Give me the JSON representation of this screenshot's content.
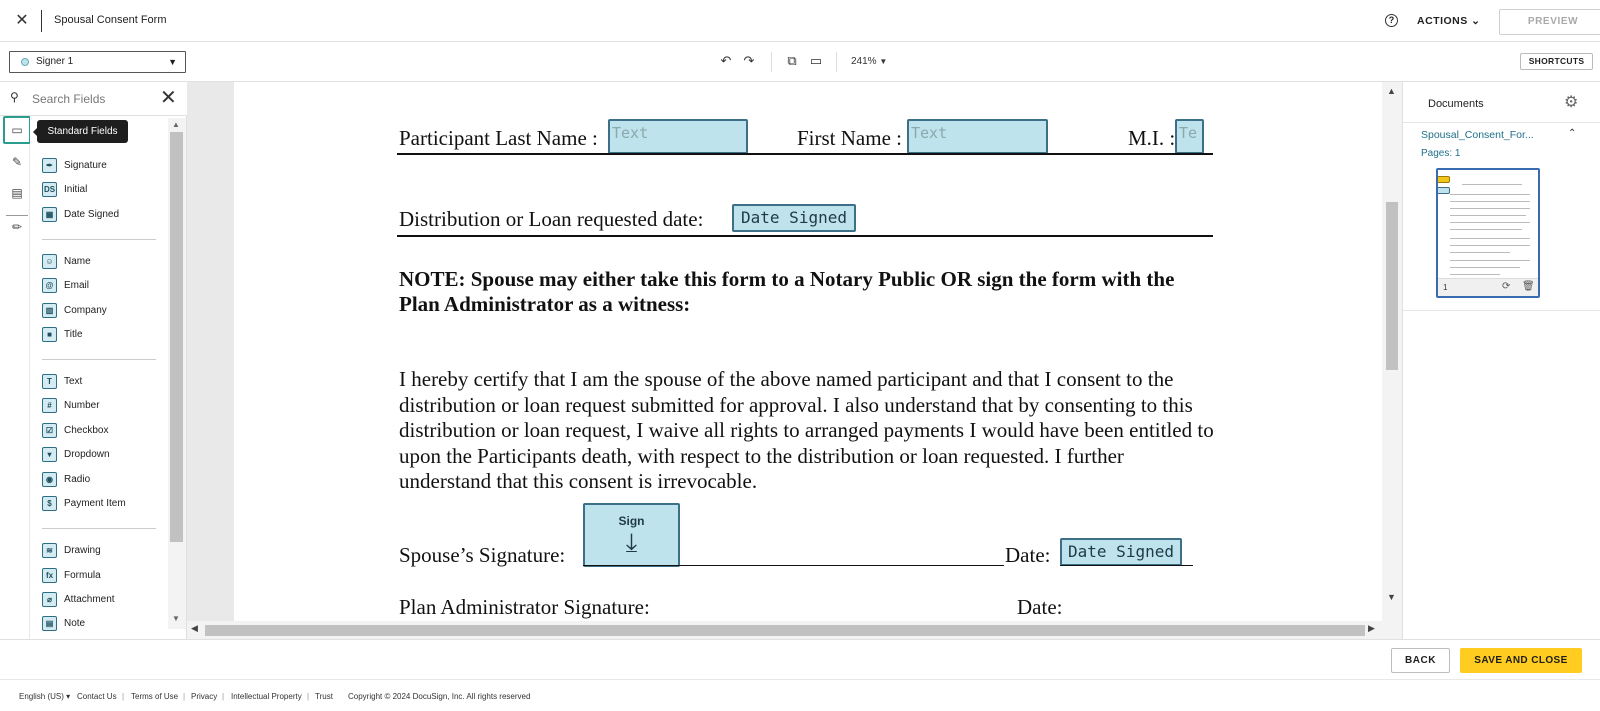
{
  "window": {
    "title": "Spousal Consent Form"
  },
  "header": {
    "actions_label": "ACTIONS",
    "preview_label": "PREVIEW"
  },
  "toolbar": {
    "signer_selected": "Signer 1",
    "zoom": "241%",
    "shortcuts_label": "SHORTCUTS"
  },
  "search": {
    "placeholder": "Search Fields"
  },
  "tooltip": "Standard Fields",
  "field_groups": [
    {
      "items": [
        {
          "label": "Signature",
          "icon": "pen-icon"
        },
        {
          "label": "Initial",
          "icon": "initial-icon",
          "glyph": "DS"
        },
        {
          "label": "Date Signed",
          "icon": "calendar-icon"
        }
      ]
    },
    {
      "items": [
        {
          "label": "Name",
          "icon": "person-icon"
        },
        {
          "label": "Email",
          "icon": "at-icon",
          "glyph": "@"
        },
        {
          "label": "Company",
          "icon": "building-icon"
        },
        {
          "label": "Title",
          "icon": "briefcase-icon"
        }
      ]
    },
    {
      "items": [
        {
          "label": "Text",
          "icon": "text-icon",
          "glyph": "T"
        },
        {
          "label": "Number",
          "icon": "hash-icon",
          "glyph": "#"
        },
        {
          "label": "Checkbox",
          "icon": "checkbox-icon"
        },
        {
          "label": "Dropdown",
          "icon": "dropdown-icon"
        },
        {
          "label": "Radio",
          "icon": "radio-icon"
        },
        {
          "label": "Payment Item",
          "icon": "payment-icon"
        }
      ]
    },
    {
      "items": [
        {
          "label": "Drawing",
          "icon": "drawing-icon"
        },
        {
          "label": "Formula",
          "icon": "formula-icon",
          "glyph": "fx"
        },
        {
          "label": "Attachment",
          "icon": "paperclip-icon"
        },
        {
          "label": "Note",
          "icon": "note-icon"
        }
      ]
    }
  ],
  "document": {
    "participant_last_name_label": "Participant Last Name :",
    "first_name_label": "First Name :",
    "mi_label": "M.I. :",
    "text_placeholder": "Text",
    "mi_placeholder": "Te",
    "distribution_label": "Distribution  or Loan requested date:",
    "date_signed": "Date Signed",
    "note": "NOTE: Spouse may either take this form to a Notary Public OR sign the form with the Plan Administrator as a witness:",
    "paragraph": "I hereby certify that I am the spouse of the above named participant and that I consent to the distribution or loan request submitted for approval. I also understand that by consenting to this distribution or loan request, I waive all rights to arranged payments I would have been entitled to upon the Participants death, with respect to the distribution or loan requested. I further understand that this consent is irrevocable.",
    "spouse_signature_label": "Spouse’s Signature:",
    "sign_label": "Sign",
    "date_label": "Date:",
    "plan_admin_label": "Plan Administrator Signature:",
    "date_label_2": "Date:"
  },
  "documents_panel": {
    "title": "Documents",
    "doc_name": "Spousal_Consent_For...",
    "pages": "Pages: 1",
    "page_number": "1"
  },
  "actionbar": {
    "back_label": "BACK",
    "save_label": "SAVE AND CLOSE"
  },
  "footer": {
    "language": "English (US) ▾",
    "links": [
      "Contact Us",
      "Terms of Use",
      "Privacy",
      "Intellectual Property",
      "Trust"
    ],
    "copyright": "Copyright © 2024 DocuSign, Inc. All rights reserved"
  },
  "colors": {
    "accent": "#ffcc1f",
    "field_fill": "#bfe3ec",
    "field_border": "#3d6f87",
    "active_rail": "#2a9d8f"
  }
}
